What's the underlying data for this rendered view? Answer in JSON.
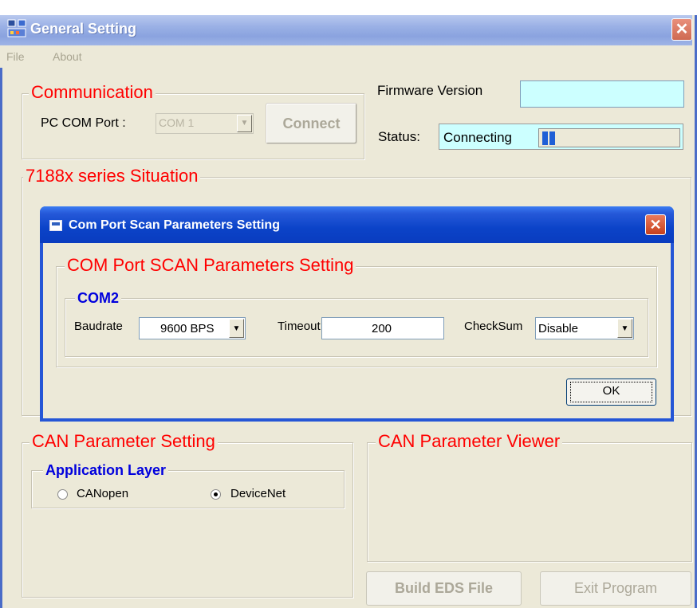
{
  "window": {
    "title": "General Setting",
    "close_glyph": "✕"
  },
  "menu": {
    "file": "File",
    "about": "About"
  },
  "communication": {
    "title": "Communication",
    "com_port_label": "PC COM Port :",
    "com_port_value": "COM 1",
    "connect_label": "Connect"
  },
  "firmware": {
    "label": "Firmware Version",
    "value": ""
  },
  "status": {
    "label": "Status:",
    "value": "Connecting",
    "progress_cells": 2
  },
  "situation": {
    "title": "7188x series Situation"
  },
  "dialog": {
    "title": "Com Port Scan Parameters Setting",
    "close_glyph": "✕",
    "group_title": "COM Port SCAN Parameters Setting",
    "com_title": "COM2",
    "baudrate_label": "Baudrate",
    "baudrate_value": "9600 BPS",
    "timeout_label": "Timeout",
    "timeout_value": "200",
    "checksum_label": "CheckSum",
    "checksum_value": "Disable",
    "ok_label": "OK"
  },
  "can_setting": {
    "title": "CAN Parameter Setting",
    "app_layer_title": "Application Layer",
    "options": [
      "CANopen",
      "DeviceNet"
    ],
    "selected": "DeviceNet"
  },
  "can_viewer": {
    "title": "CAN Parameter Viewer"
  },
  "buttons": {
    "build_eds": "Build EDS File",
    "exit": "Exit Program"
  },
  "colors": {
    "dialog_title_blue": "#0a3cbf",
    "group_title_red": "#ff0000",
    "firmware_field": "#ccffff"
  }
}
